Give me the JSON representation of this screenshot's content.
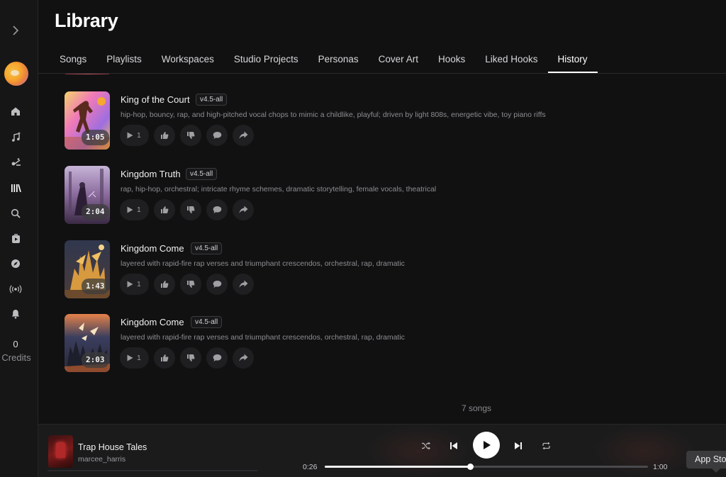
{
  "page": {
    "title": "Library"
  },
  "tabs": [
    {
      "label": "Songs"
    },
    {
      "label": "Playlists"
    },
    {
      "label": "Workspaces"
    },
    {
      "label": "Studio Projects"
    },
    {
      "label": "Personas"
    },
    {
      "label": "Cover Art"
    },
    {
      "label": "Hooks"
    },
    {
      "label": "Liked Hooks"
    },
    {
      "label": "History",
      "active": true
    }
  ],
  "sidebar": {
    "credits_count": "0",
    "credits_label": "Credits",
    "icons": [
      "chevron-right-icon",
      "home-icon",
      "create-music-icon",
      "studio-icon",
      "library-icon",
      "search-icon",
      "hooks-icon",
      "explore-icon",
      "radio-icon",
      "notifications-icon"
    ]
  },
  "songs": [
    {
      "title": "King of the Court",
      "version": "v4.5-all",
      "description": "hip-hop, bouncy, rap, and high-pitched vocal chops to mimic a childlike, playful; driven by light 808s, energetic vibe, toy piano riffs",
      "duration": "1:05",
      "plays": "1"
    },
    {
      "title": "Kingdom Truth",
      "version": "v4.5-all",
      "description": "rap, hip-hop, orchestral; intricate rhyme schemes, dramatic storytelling, female vocals, theatrical",
      "duration": "2:04",
      "plays": "1"
    },
    {
      "title": "Kingdom Come",
      "version": "v4.5-all",
      "description": "layered with rapid-fire rap verses and triumphant crescendos, orchestral, rap, dramatic",
      "duration": "1:43",
      "plays": "1"
    },
    {
      "title": "Kingdom Come",
      "version": "v4.5-all",
      "description": "layered with rapid-fire rap verses and triumphant crescendos, orchestral, rap, dramatic",
      "duration": "2:03",
      "plays": "1"
    }
  ],
  "list_footer": {
    "count_text": "7 songs"
  },
  "player": {
    "title": "Trap House Tales",
    "artist": "marcee_harris",
    "current_time": "0:26",
    "total_time": "1:00",
    "progress": 0.45
  },
  "tooltip": {
    "label": "App Store"
  }
}
